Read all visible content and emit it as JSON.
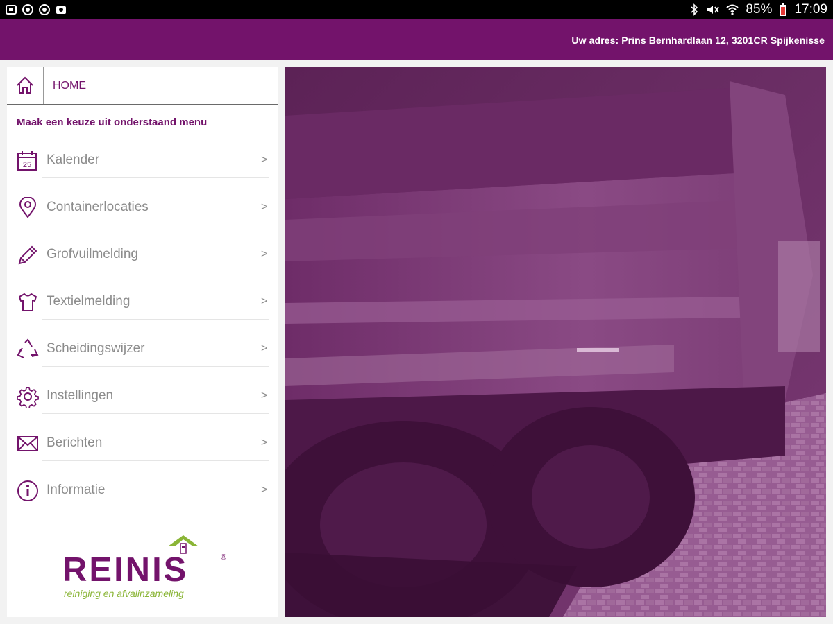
{
  "status_bar": {
    "battery": "85%",
    "time": "17:09"
  },
  "header": {
    "address": "Uw adres: Prins Bernhardlaan 12, 3201CR Spijkenisse"
  },
  "nav": {
    "home_label": "HOME"
  },
  "menu": {
    "heading": "Maak een keuze uit onderstaand menu",
    "arrow": ">",
    "calendar_day": "25",
    "items": [
      {
        "label": "Kalender",
        "icon": "calendar-icon"
      },
      {
        "label": "Containerlocaties",
        "icon": "location-pin-icon"
      },
      {
        "label": "Grofvuilmelding",
        "icon": "pencil-icon"
      },
      {
        "label": "Textielmelding",
        "icon": "tshirt-icon"
      },
      {
        "label": "Scheidingswijzer",
        "icon": "recycle-icon"
      },
      {
        "label": "Instellingen",
        "icon": "gear-icon"
      },
      {
        "label": "Berichten",
        "icon": "envelope-icon"
      },
      {
        "label": "Informatie",
        "icon": "info-icon"
      }
    ]
  },
  "logo": {
    "name": "REINIS",
    "registered": "®",
    "tagline": "reiniging en afvalinzameling"
  },
  "colors": {
    "brand_purple": "#73136b",
    "brand_green": "#8ab536",
    "menu_text": "#8c8c8c"
  }
}
